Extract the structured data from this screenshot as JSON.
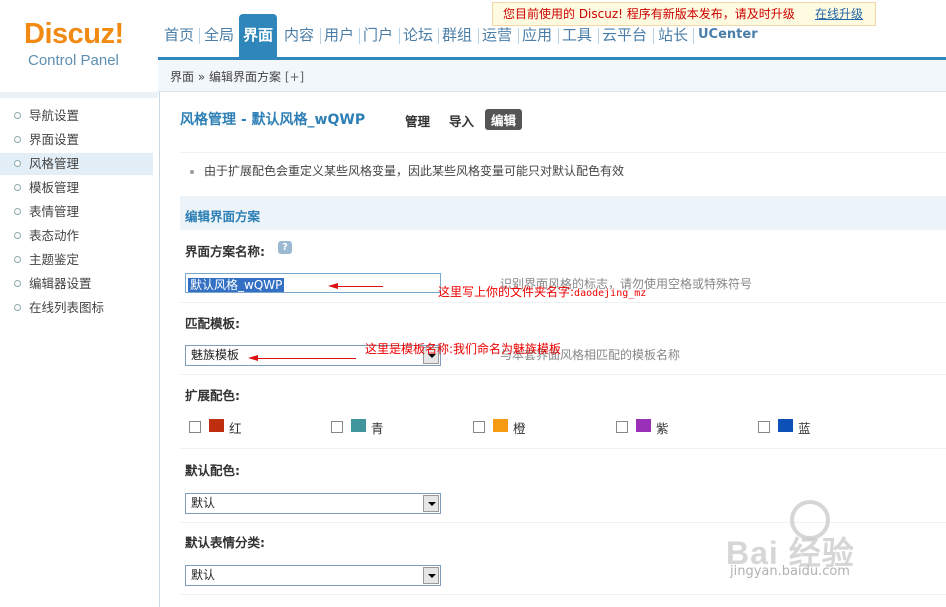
{
  "logo": {
    "brand": "Discuz!",
    "subtitle": "Control Panel"
  },
  "notice": {
    "message": "您目前使用的 Discuz! 程序有新版本发布，请及时升级",
    "link": "在线升级"
  },
  "nav": {
    "items": [
      "首页",
      "全局",
      "界面",
      "内容",
      "用户",
      "门户",
      "论坛",
      "群组",
      "运营",
      "应用",
      "工具",
      "云平台",
      "站长",
      "UCenter"
    ],
    "active": "界面"
  },
  "breadcrumb": {
    "path": "界面 » 编辑界面方案",
    "plus": "[+]"
  },
  "sidebar": {
    "items": [
      "导航设置",
      "界面设置",
      "风格管理",
      "模板管理",
      "表情管理",
      "表态动作",
      "主题鉴定",
      "编辑器设置",
      "在线列表图标"
    ],
    "active": "风格管理"
  },
  "main": {
    "title": "风格管理 - 默认风格_wQWP",
    "tabs": [
      "管理",
      "导入",
      "编辑"
    ],
    "active_tab": "编辑",
    "tip": "由于扩展配色会重定义某些风格变量，因此某些风格变量可能只对默认配色有效",
    "section": "编辑界面方案",
    "scheme_name_label": "界面方案名称:",
    "scheme_name_value": "默认风格_wQWP",
    "scheme_name_desc": "识别界面风格的标志，请勿使用空格或特殊符号",
    "template_label": "匹配模板:",
    "template_value": "魅族模板",
    "template_desc": "与本套界面风格相匹配的模板名称",
    "ext_colors_label": "扩展配色:",
    "ext_colors": [
      {
        "name": "红",
        "color": "#bf2e0f"
      },
      {
        "name": "青",
        "color": "#40969c"
      },
      {
        "name": "橙",
        "color": "#f59b12"
      },
      {
        "name": "紫",
        "color": "#9a2fb8"
      },
      {
        "name": "蓝",
        "color": "#0c50b8"
      }
    ],
    "default_color_label": "默认配色:",
    "default_color_value": "默认",
    "default_emoji_label": "默认表情分类:",
    "default_emoji_value": "默认"
  },
  "annotations": {
    "folder_note": "这里写上你的文件夹名字:",
    "folder_code": "daodejing_mz",
    "template_note": "这里是模板名称:我们命名为魅族模板"
  },
  "watermark": {
    "brand": "Bai 经验",
    "url": "jingyan.baidu.com"
  }
}
